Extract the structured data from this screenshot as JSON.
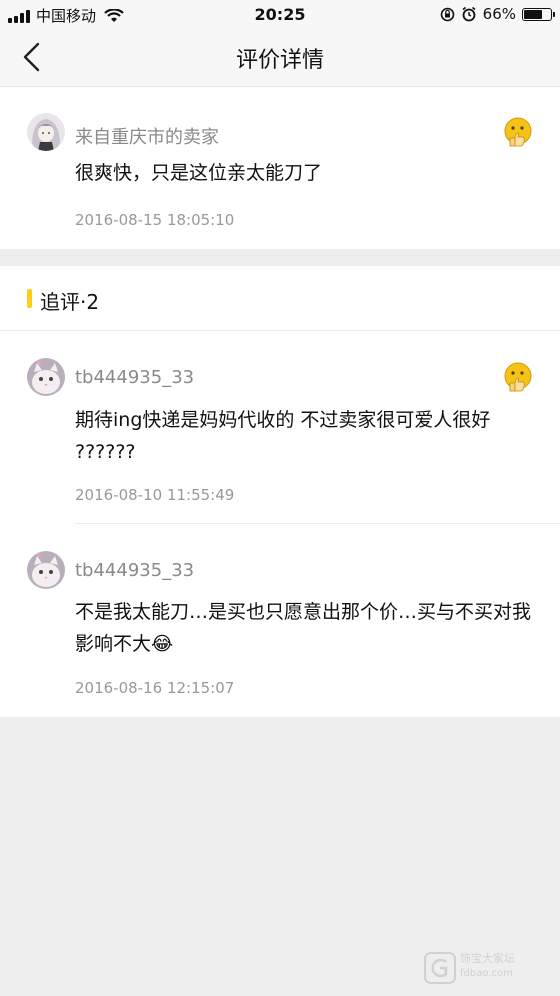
{
  "status_bar": {
    "carrier": "中国移动",
    "time": "20:25",
    "battery_percent_label": "66%",
    "battery_level": 0.66
  },
  "nav": {
    "title": "评价详情"
  },
  "main_review": {
    "username": "来自重庆市的卖家",
    "content": "很爽快，只是这位亲太能刀了",
    "timestamp": "2016-08-15 18:05:10"
  },
  "followups": {
    "title": "追评·2",
    "items": [
      {
        "username": "tb444935_33",
        "content": "期待ing快递是妈妈代收的 不过卖家很可爱人很好 ??????",
        "timestamp": "2016-08-10 11:55:49"
      },
      {
        "username": "tb444935_33",
        "content": "不是我太能刀…是买也只愿意出那个价…买与不买对我影响不大😂",
        "timestamp": "2016-08-16 12:15:07"
      }
    ]
  },
  "watermark": {
    "line1": "饰宝大家坛",
    "line2": "fdbao.com"
  },
  "colors": {
    "accent": "#ffcc1a",
    "background": "#eeeeee",
    "emoji_yellow": "#f5c218"
  }
}
